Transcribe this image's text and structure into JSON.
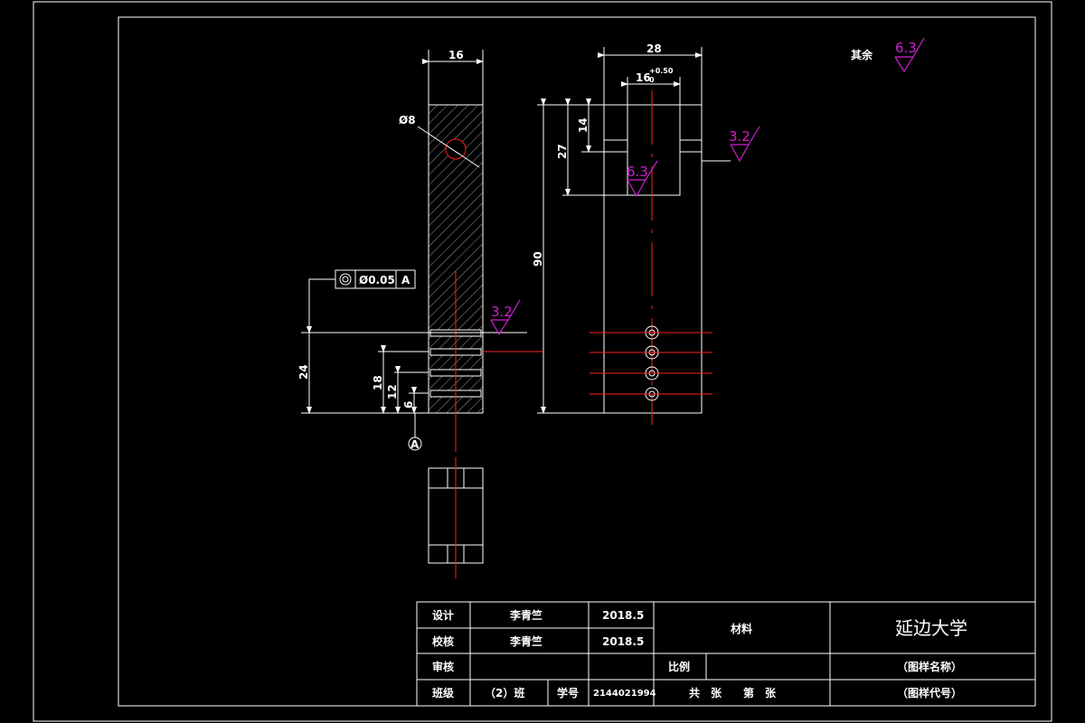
{
  "colors": {
    "background": "#000000",
    "lines": "#ffffff",
    "centerlines": "#ff2020",
    "roughness": "#d020d0"
  },
  "dimensions": {
    "width_left": "16",
    "width_right": "28",
    "slot_width": "16",
    "slot_tolerance": "+0.50",
    "slot_tolerance_zero": "0",
    "hole_dia": "Ø8",
    "height_90": "90",
    "height_27": "27",
    "height_14": "14",
    "dim_24": "24",
    "dim_18": "18",
    "dim_12": "12",
    "dim_6": "6"
  },
  "roughness": {
    "rest_label": "其余",
    "rest_value": "6.3",
    "r1": "3.2",
    "r2": "6.3",
    "r3": "3.2"
  },
  "tolerance_frame": {
    "value": "Ø0.05",
    "datum": "A"
  },
  "datum_label": "A",
  "title_block": {
    "design_label": "设计",
    "design_name": "李青竺",
    "design_date": "2018.5",
    "check_label": "校核",
    "check_name": "李青竺",
    "check_date": "2018.5",
    "review_label": "审核",
    "class_label": "班级",
    "class_value": "（2）班",
    "student_no_label": "学号",
    "student_no": "2144021994",
    "material_label": "材料",
    "scale_label": "比例",
    "university": "延边大学",
    "drawing_name": "（图样名称）",
    "drawing_code": "（图样代号）",
    "sheets": "共　张　　第　张"
  }
}
